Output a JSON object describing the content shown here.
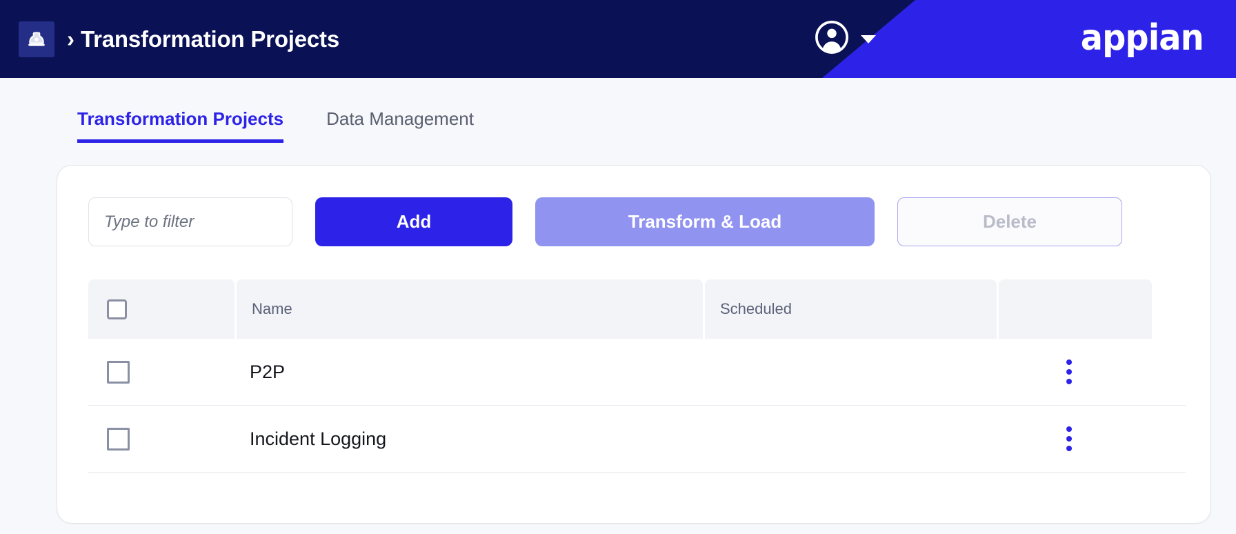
{
  "topbar": {
    "app_icon": "hard-hat-icon",
    "breadcrumb_separator": "›",
    "title": "Transformation Projects",
    "user_icon": "user-account-icon",
    "user_caret": "chevron-down-icon",
    "brand": "appian",
    "colors": {
      "bar_bg": "#0a1154",
      "wedge_bg": "#2d23e8",
      "icon_tile": "#242e86",
      "text": "#ffffff"
    }
  },
  "tabs": [
    {
      "label": "Transformation Projects",
      "active": true
    },
    {
      "label": "Data Management",
      "active": false
    }
  ],
  "toolbar": {
    "filter_placeholder": "Type to filter",
    "filter_value": "",
    "add_label": "Add",
    "transform_label": "Transform & Load",
    "delete_label": "Delete",
    "colors": {
      "primary": "#2d23e8",
      "secondary": "#9193f0",
      "disabled_text": "#b9bcc8",
      "disabled_border": "#a8a6ef"
    }
  },
  "table": {
    "headers": {
      "select_all": "",
      "name": "Name",
      "scheduled": "Scheduled",
      "actions": ""
    },
    "rows": [
      {
        "selected": false,
        "name": "P2P",
        "scheduled": "",
        "menu": "more-options-icon"
      },
      {
        "selected": false,
        "name": "Incident Logging",
        "scheduled": "",
        "menu": "more-options-icon"
      }
    ]
  }
}
